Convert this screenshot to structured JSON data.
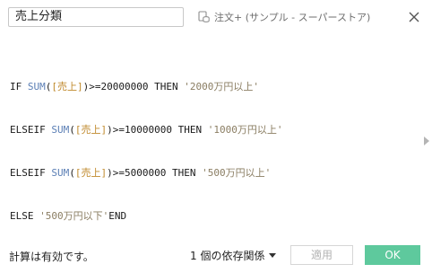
{
  "calc_name": "売上分類",
  "datasource": {
    "label": "注文+ (サンプル - スーパーストア)",
    "icon": "datasource-icon"
  },
  "formula": {
    "line1": {
      "kw": "IF ",
      "fn": "SUM",
      "p1": "(",
      "field": "[売上]",
      "p2": ")>=20000000 THEN ",
      "str": "'2000万円以上'"
    },
    "line2": {
      "kw": "ELSEIF ",
      "fn": "SUM",
      "p1": "(",
      "field": "[売上]",
      "p2": ")>=10000000 THEN ",
      "str": "'1000万円以上'"
    },
    "line3": {
      "kw": "ELSEIF ",
      "fn": "SUM",
      "p1": "(",
      "field": "[売上]",
      "p2": ")>=5000000 THEN ",
      "str": "'500万円以上'"
    },
    "line4": {
      "kw": "ELSE ",
      "str": "'500万円以下'",
      "end": "END"
    }
  },
  "footer": {
    "status": "計算は有効です。",
    "dependencies": "1 個の依存関係",
    "apply_label": "適用",
    "ok_label": "OK"
  },
  "colors": {
    "ok_button": "#5ec99d",
    "function": "#5b7fb5",
    "field": "#c08a2c",
    "string": "#8a7d62"
  }
}
